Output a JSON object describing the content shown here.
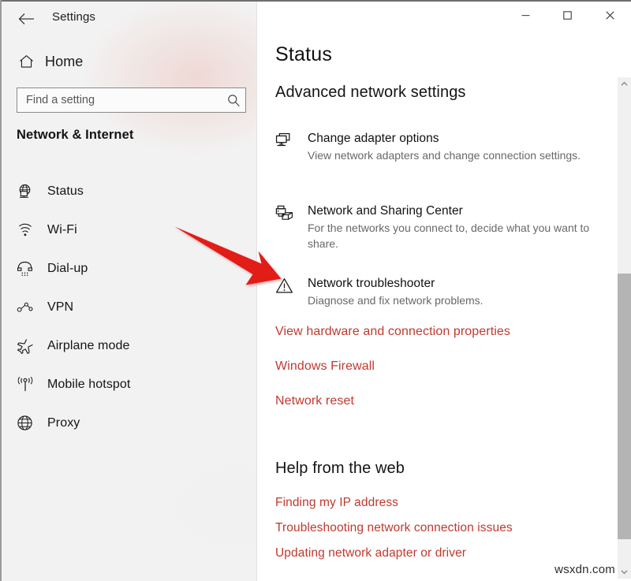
{
  "window": {
    "title": "Settings",
    "back_icon": "back-arrow-icon",
    "controls": {
      "minimize": "─",
      "maximize": "□",
      "close": "✕"
    }
  },
  "sidebar": {
    "home_label": "Home",
    "home_icon": "home-icon",
    "search": {
      "placeholder": "Find a setting",
      "value": "",
      "icon": "search-icon"
    },
    "heading": "Network & Internet",
    "selected_accent": "#e81123",
    "items": [
      {
        "label": "Status",
        "icon": "globe-status-icon",
        "selected": true
      },
      {
        "label": "Wi-Fi",
        "icon": "wifi-icon",
        "selected": false
      },
      {
        "label": "Dial-up",
        "icon": "phone-handset-icon",
        "selected": false
      },
      {
        "label": "VPN",
        "icon": "vpn-icon",
        "selected": false
      },
      {
        "label": "Airplane mode",
        "icon": "airplane-icon",
        "selected": false
      },
      {
        "label": "Mobile hotspot",
        "icon": "hotspot-icon",
        "selected": false
      },
      {
        "label": "Proxy",
        "icon": "globe-icon",
        "selected": false
      }
    ]
  },
  "content": {
    "page_title": "Status",
    "section_title": "Advanced network settings",
    "entries": [
      {
        "title": "Change adapter options",
        "desc": "View network adapters and change connection settings.",
        "icon": "two-monitors-icon"
      },
      {
        "title": "Network and Sharing Center",
        "desc": "For the networks you connect to, decide what you want to share.",
        "icon": "printer-folder-icon"
      },
      {
        "title": "Network troubleshooter",
        "desc": "Diagnose and fix network problems.",
        "icon": "warning-triangle-icon"
      }
    ],
    "links": [
      "View hardware and connection properties",
      "Windows Firewall",
      "Network reset"
    ],
    "link_color": "#c0392f",
    "help": {
      "title": "Help from the web",
      "links": [
        "Finding my IP address",
        "Troubleshooting network connection issues",
        "Updating network adapter or driver"
      ]
    }
  },
  "scrollbar": {
    "up_icon": "chevron-up-icon",
    "down_icon": "chevron-down-icon"
  },
  "annotation": {
    "type": "red-arrow",
    "color": "#e01b18",
    "points_to": "Network troubleshooter"
  },
  "watermark": "wsxdn.com"
}
